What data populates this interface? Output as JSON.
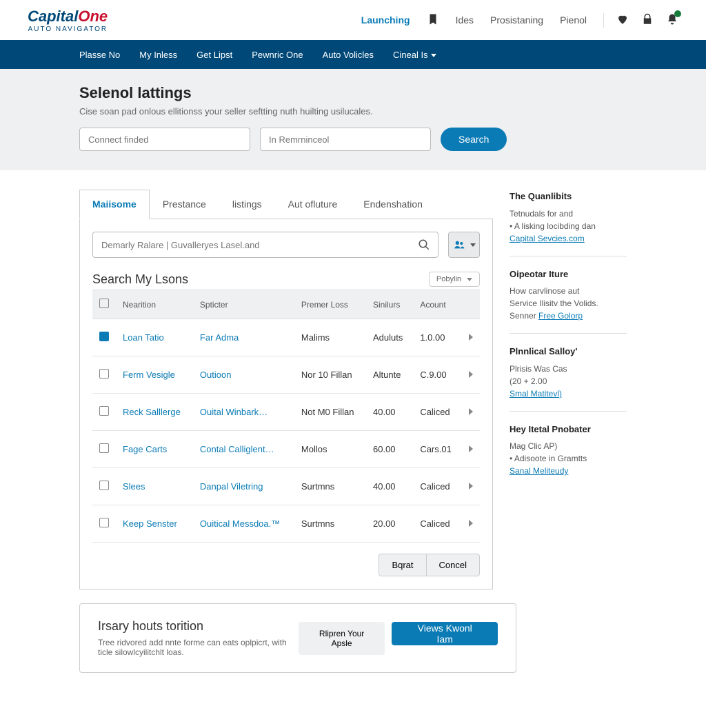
{
  "logo": {
    "brand": "CapitalOne",
    "sub": "AUTO NAVIGATOR"
  },
  "topnav": {
    "launching": "Launching",
    "ides": "Ides",
    "prostaning": "Prosistaning",
    "pienol": "Pienol"
  },
  "navbar": {
    "please_no": "Plasse No",
    "my_inles": "My Inless",
    "get_lipst": "Get Lipst",
    "pewneric": "Pewnric One",
    "auto_vehicles": "Auto Volicles",
    "cinel": "Cineal Is"
  },
  "hero": {
    "title": "Selenol lattings",
    "subtitle": "Cise soan pad onlous ellitionss your seller seftting nuth huilting usilucales.",
    "placeholder1": "Connect finded",
    "placeholder2": "In Remrninceol",
    "search": "Search"
  },
  "tabs": {
    "maisome": "Maiisome",
    "prestance": "Prestance",
    "listings": "listings",
    "aut_culture": "Aut ofluture",
    "endenshation": "Endenshation"
  },
  "panel": {
    "search_placeholder": "Demarly Ralare | Guvalleryes Lasel.and",
    "heading": "Search My Lsons",
    "sort_label": "Pobylin"
  },
  "columns": {
    "check": "",
    "nearition": "Nearition",
    "spticter": "Spticter",
    "premer": "Premer Loss",
    "sinlurs": "Sinilurs",
    "account": "Acount"
  },
  "rows": [
    {
      "checked": true,
      "c1": "Loan Tatio",
      "c2": "Far Adma",
      "c3": "Malims",
      "c4": "Aduluts",
      "c5": "1.0.00"
    },
    {
      "checked": false,
      "c1": "Ferm Vesigle",
      "c2": "Outioon",
      "c3": "Nor 10 Fillan",
      "c4": "Altunte",
      "c5": "C.9.00"
    },
    {
      "checked": false,
      "c1": "Reck Salllerge",
      "c2": "Ouital Winbark…",
      "c3": "Not M0 Fillan",
      "c4": "40.00",
      "c5": "Caliced"
    },
    {
      "checked": false,
      "c1": "Fage Carts",
      "c2": "Contal Calliglent…",
      "c3": "Mollos",
      "c4": "60.00",
      "c5": "Cars.01"
    },
    {
      "checked": false,
      "c1": "Slees",
      "c2": "Danpal Viletring",
      "c3": "Surtmns",
      "c4": "40.00",
      "c5": "Caliced"
    },
    {
      "checked": false,
      "c1": "Keep Senster",
      "c2": "Ouitical Messdoa.™",
      "c3": "Surtmns",
      "c4": "20.00",
      "c5": "Caliced"
    }
  ],
  "actions": {
    "bqrat": "Bqrat",
    "concel": "Concel"
  },
  "side": {
    "b1_title": "The Quanlibits",
    "b1_l1": "Tetnudals for and",
    "b1_l2": "• A lisking locibding dan",
    "b1_link": "Capital Sevcies.com",
    "b2_title": "Oipeotar Iture",
    "b2_l1": "How carvlinose aut",
    "b2_l2": "Service Ilisitv the Volids.",
    "b2_l3": "Senner",
    "b2_link": "Free Golorp",
    "b3_title": "Plnnlical Salloy'",
    "b3_l1": "Plrisis Was Cas",
    "b3_l2": "(20 + 2.00",
    "b3_link": "Smal Matitevl)",
    "b4_title": "Hey Itetal Pnobater",
    "b4_l1": "Mag Clic AP)",
    "b4_l2": "• Adisoote in Gramtts",
    "b4_link": "Sanal Meliteudy"
  },
  "promo": {
    "title": "Irsary houts torition",
    "body": "Tree ridvored add nnte forme can eats oplpicrt, with ticle silowlcyilitchlt loas.",
    "btn1": "Rlipren Your Apsle",
    "btn2": "Views Kwonl Iam"
  }
}
